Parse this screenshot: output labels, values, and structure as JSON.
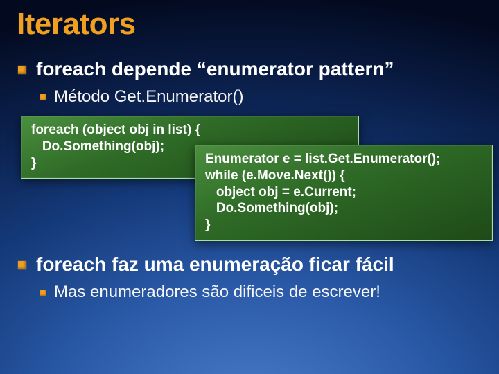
{
  "title": "Iterators",
  "bullets": {
    "b1": "foreach depende “enumerator pattern”",
    "b1_sub1": "Método Get.Enumerator()",
    "b2": "foreach faz uma enumeração ficar fácil",
    "b2_sub1": "Mas enumeradores são dificeis de escrever!"
  },
  "code": {
    "foreach_block": "foreach (object obj in list) {\n   Do.Something(obj);\n}",
    "expanded_block": "Enumerator e = list.Get.Enumerator();\nwhile (e.Move.Next()) {\n   object obj = e.Current;\n   Do.Something(obj);\n}"
  }
}
